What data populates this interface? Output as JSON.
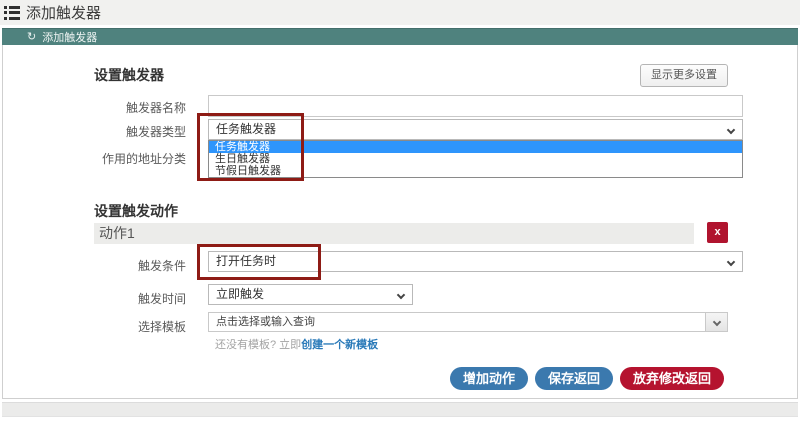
{
  "window": {
    "title": "添加触发器"
  },
  "breadcrumb": {
    "label": "添加触发器"
  },
  "trigger_section": {
    "heading": "设置触发器",
    "more_settings_button": "显示更多设置",
    "name_label": "触发器名称",
    "name_value": "",
    "type_label": "触发器类型",
    "type_selected": "任务触发器",
    "type_options": [
      "任务触发器",
      "生日触发器",
      "节假日触发器"
    ],
    "address_category_label": "作用的地址分类"
  },
  "action_section": {
    "heading": "设置触发动作",
    "action_title": "动作1",
    "remove_button": "x",
    "condition_label": "触发条件",
    "condition_selected": "打开任务时",
    "time_label": "触发时间",
    "time_selected": "立即触发",
    "template_label": "选择模板",
    "template_placeholder": "点击选择或输入查询",
    "template_hint": "还没有模板? 立即",
    "template_hint_link": "创建一个新模板"
  },
  "footer": {
    "add_action_button": "增加动作",
    "save_button": "保存返回",
    "discard_button": "放弃修改返回"
  },
  "colors": {
    "teal_bar": "#4f827e",
    "dropdown_highlight": "#2e95fc",
    "danger_red": "#b0142f",
    "primary_blue": "#3b79ae",
    "annotation_red": "#8e1b15",
    "link_blue": "#2a7ab9"
  }
}
